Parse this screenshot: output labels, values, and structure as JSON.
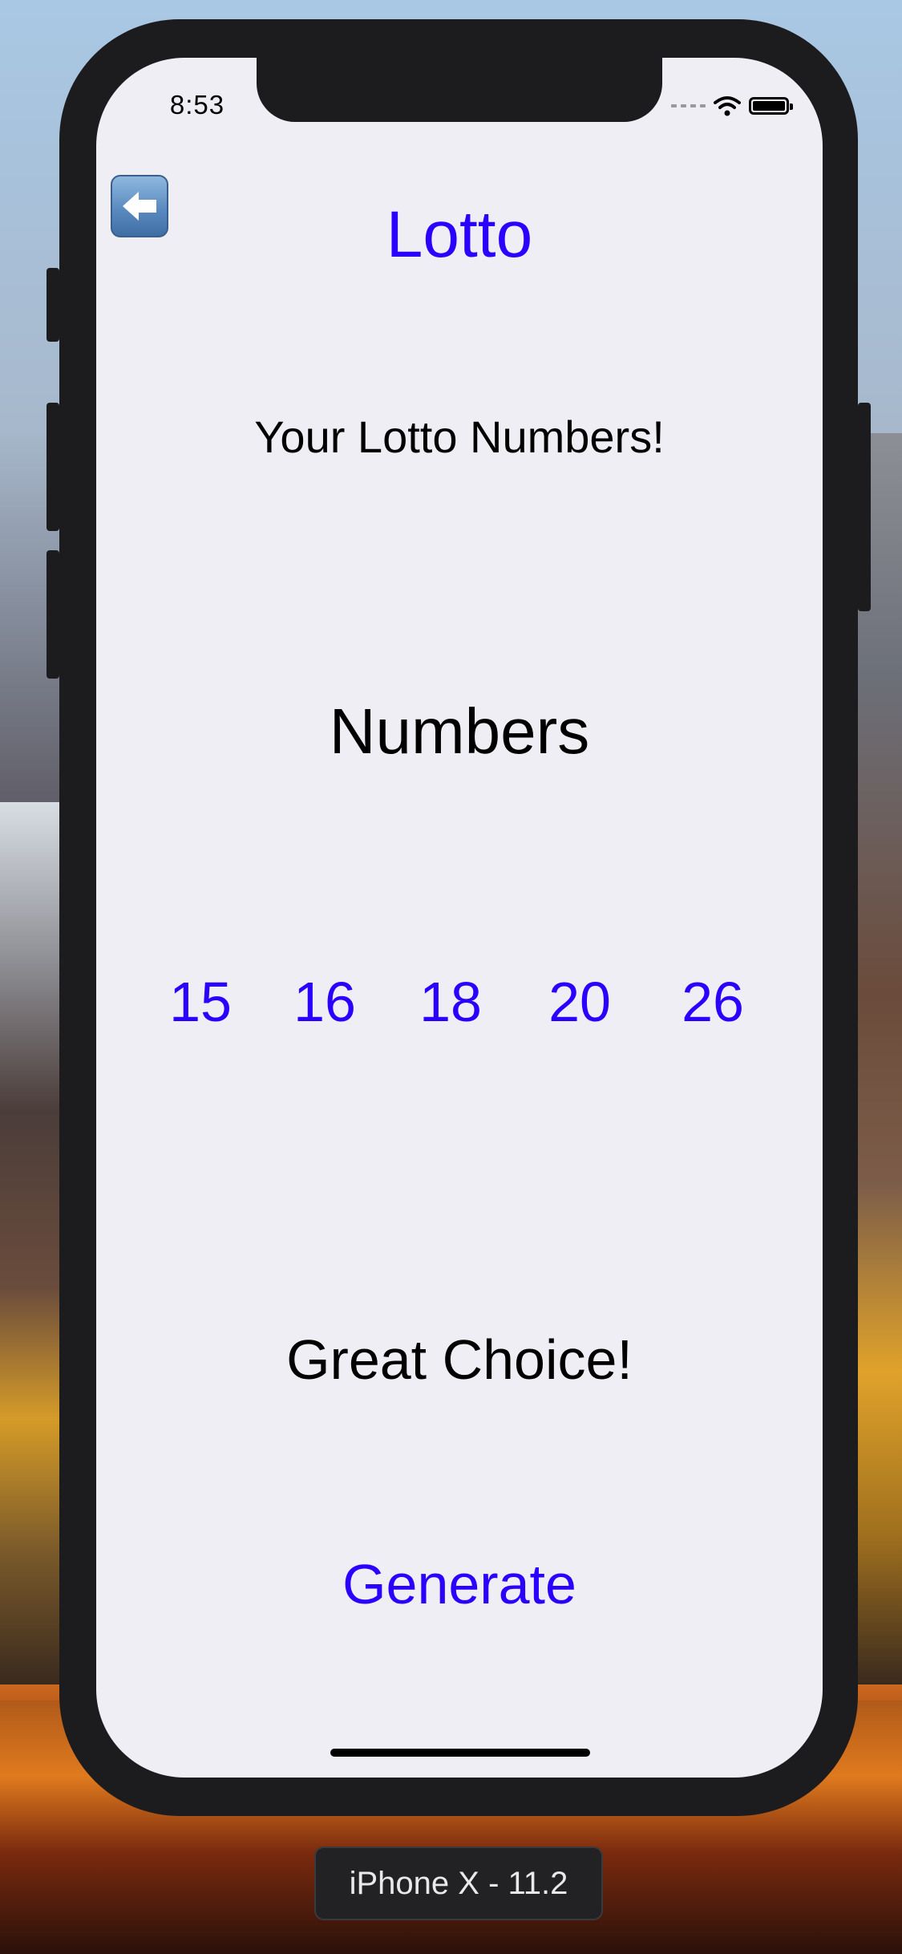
{
  "status_bar": {
    "time": "8:53"
  },
  "nav": {
    "title": "Lotto",
    "back_icon": "arrow-left-icon"
  },
  "content": {
    "subtitle": "Your Lotto Numbers!",
    "heading": "Numbers",
    "numbers": [
      "15",
      "16",
      "18",
      "20",
      "26"
    ],
    "message": "Great Choice!",
    "generate_label": "Generate"
  },
  "simulator": {
    "device_label": "iPhone X - 11.2"
  },
  "colors": {
    "accent": "#2a00ff",
    "screen_background": "#efeef4",
    "frame": "#1c1c1e"
  }
}
